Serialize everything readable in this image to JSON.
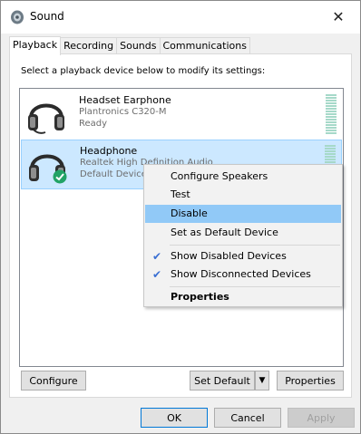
{
  "window": {
    "title": "Sound"
  },
  "tabs": [
    {
      "label": "Playback",
      "active": true
    },
    {
      "label": "Recording",
      "active": false
    },
    {
      "label": "Sounds",
      "active": false
    },
    {
      "label": "Communications",
      "active": false
    }
  ],
  "playback": {
    "instruction": "Select a playback device below to modify its settings:",
    "devices": [
      {
        "name": "Headset Earphone",
        "line1": "Plantronics C320-M",
        "line2": "Ready",
        "icon": "headphone-icon",
        "selected": false,
        "is_default": false
      },
      {
        "name": "Headphone",
        "line1": "Realtek High Definition Audio",
        "line2": "Default Device",
        "icon": "headphone-icon",
        "selected": true,
        "is_default": true
      }
    ],
    "buttons": {
      "configure": "Configure",
      "set_default": "Set Default",
      "properties": "Properties"
    }
  },
  "context_menu": {
    "items": [
      {
        "label": "Configure Speakers",
        "checked": false,
        "highlighted": false,
        "bold": false
      },
      {
        "label": "Test",
        "checked": false,
        "highlighted": false,
        "bold": false
      },
      {
        "label": "Disable",
        "checked": false,
        "highlighted": true,
        "bold": false
      },
      {
        "label": "Set as Default Device",
        "checked": false,
        "highlighted": false,
        "bold": false
      },
      {
        "label": "Show Disabled Devices",
        "checked": true,
        "highlighted": false,
        "bold": false
      },
      {
        "label": "Show Disconnected Devices",
        "checked": true,
        "highlighted": false,
        "bold": false
      },
      {
        "label": "Properties",
        "checked": false,
        "highlighted": false,
        "bold": true
      }
    ]
  },
  "dialog_buttons": {
    "ok": "OK",
    "cancel": "Cancel",
    "apply": "Apply"
  },
  "colors": {
    "selection_bg": "#cce8ff",
    "menu_highlight": "#91c9f7",
    "default_badge": "#21a366",
    "focus_border": "#0078d7"
  }
}
